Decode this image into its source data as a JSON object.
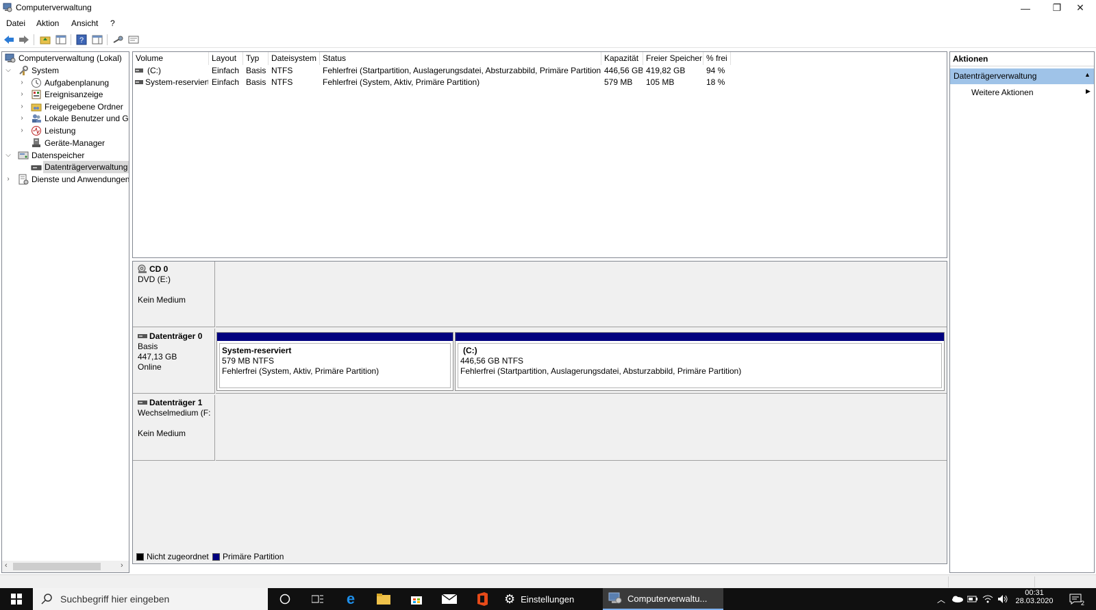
{
  "window": {
    "title": "Computerverwaltung",
    "minimize": "—",
    "maximize": "❐",
    "close": "✕"
  },
  "menu": [
    "Datei",
    "Aktion",
    "Ansicht",
    "?"
  ],
  "tree": {
    "root": "Computerverwaltung (Lokal)",
    "system": "System",
    "aufgaben": "Aufgabenplanung",
    "ereignis": "Ereignisanzeige",
    "freigaben": "Freigegebene Ordner",
    "benutzer": "Lokale Benutzer und Gr",
    "leistung": "Leistung",
    "geraete": "Geräte-Manager",
    "datenspeicher": "Datenspeicher",
    "datentraeger": "Datenträgerverwaltung",
    "dienste": "Dienste und Anwendungen"
  },
  "columns": [
    "Volume",
    "Layout",
    "Typ",
    "Dateisystem",
    "Status",
    "Kapazität",
    "Freier Speicher",
    "% frei"
  ],
  "volumes": [
    {
      "volume": "(C:)",
      "layout": "Einfach",
      "typ": "Basis",
      "fs": "NTFS",
      "status": "Fehlerfrei (Startpartition, Auslagerungsdatei, Absturzabbild, Primäre Partition)",
      "capacity": "446,56 GB",
      "free": "419,82 GB",
      "pct": "94 %"
    },
    {
      "volume": "System-reserviert",
      "layout": "Einfach",
      "typ": "Basis",
      "fs": "NTFS",
      "status": "Fehlerfrei (System, Aktiv, Primäre Partition)",
      "capacity": "579 MB",
      "free": "105 MB",
      "pct": "18 %"
    }
  ],
  "disks": {
    "cd0": {
      "name": "CD 0",
      "line1": "DVD (E:)",
      "line3": "Kein Medium"
    },
    "disk0": {
      "name": "Datenträger 0",
      "line1": "Basis",
      "line2": "447,13 GB",
      "line3": "Online",
      "p1": {
        "name": "System-reserviert",
        "size": "579 MB NTFS",
        "status": "Fehlerfrei (System, Aktiv, Primäre Partition)"
      },
      "p2": {
        "name": "(C:)",
        "size": "446,56 GB NTFS",
        "status": "Fehlerfrei (Startpartition, Auslagerungsdatei, Absturzabbild, Primäre Partition)"
      }
    },
    "disk1": {
      "name": "Datenträger 1",
      "line1": "Wechselmedium (F:",
      "line3": "Kein Medium"
    }
  },
  "legend": {
    "unallocated": "Nicht zugeordnet",
    "primary": "Primäre Partition",
    "unallocated_color": "#000000",
    "primary_color": "#00007f"
  },
  "actions": {
    "header": "Aktionen",
    "section": "Datenträgerverwaltung",
    "more": "Weitere Aktionen"
  },
  "taskbar": {
    "search_placeholder": "Suchbegriff hier eingeben",
    "settings": "Einstellungen",
    "app": "Computerverwaltu...",
    "time": "00:31",
    "date": "28.03.2020",
    "notifications": "2"
  }
}
